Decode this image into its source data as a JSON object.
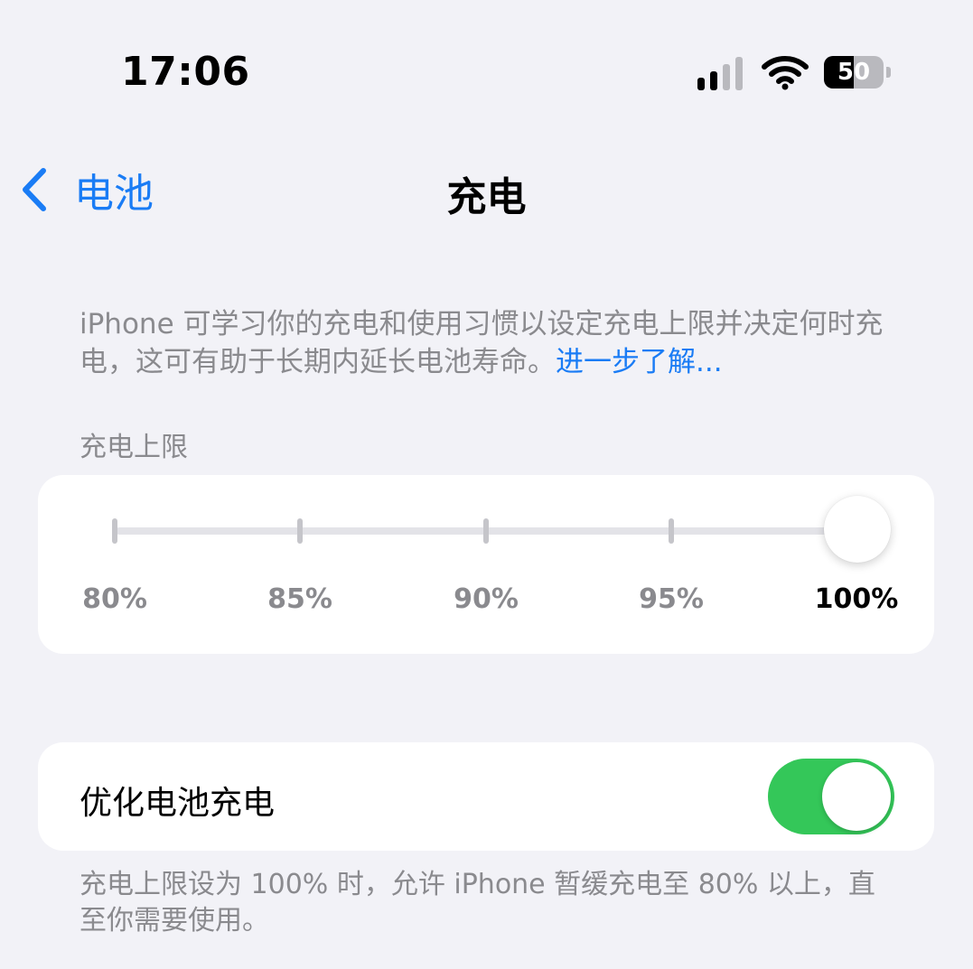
{
  "status_bar": {
    "time": "17:06",
    "battery_level": 50,
    "battery_text": "50",
    "signal_bars_active": 2
  },
  "nav": {
    "back_label": "电池",
    "title": "充电"
  },
  "description": {
    "text": "iPhone 可学习你的充电和使用习惯以设定充电上限并决定何时充电，这可有助于长期内延长电池寿命。",
    "link": "进一步了解..."
  },
  "charge_limit": {
    "header": "充电上限",
    "options": [
      "80%",
      "85%",
      "90%",
      "95%",
      "100%"
    ],
    "selected": "100%"
  },
  "optimize": {
    "label": "优化电池充电",
    "enabled": true
  },
  "footer": {
    "text": "充电上限设为 100% 时，允许 iPhone 暂缓充电至 80% 以上，直至你需要使用。"
  },
  "colors": {
    "accent": "#1a7cf5",
    "toggle_on": "#34c759",
    "background": "#f2f2f7"
  }
}
